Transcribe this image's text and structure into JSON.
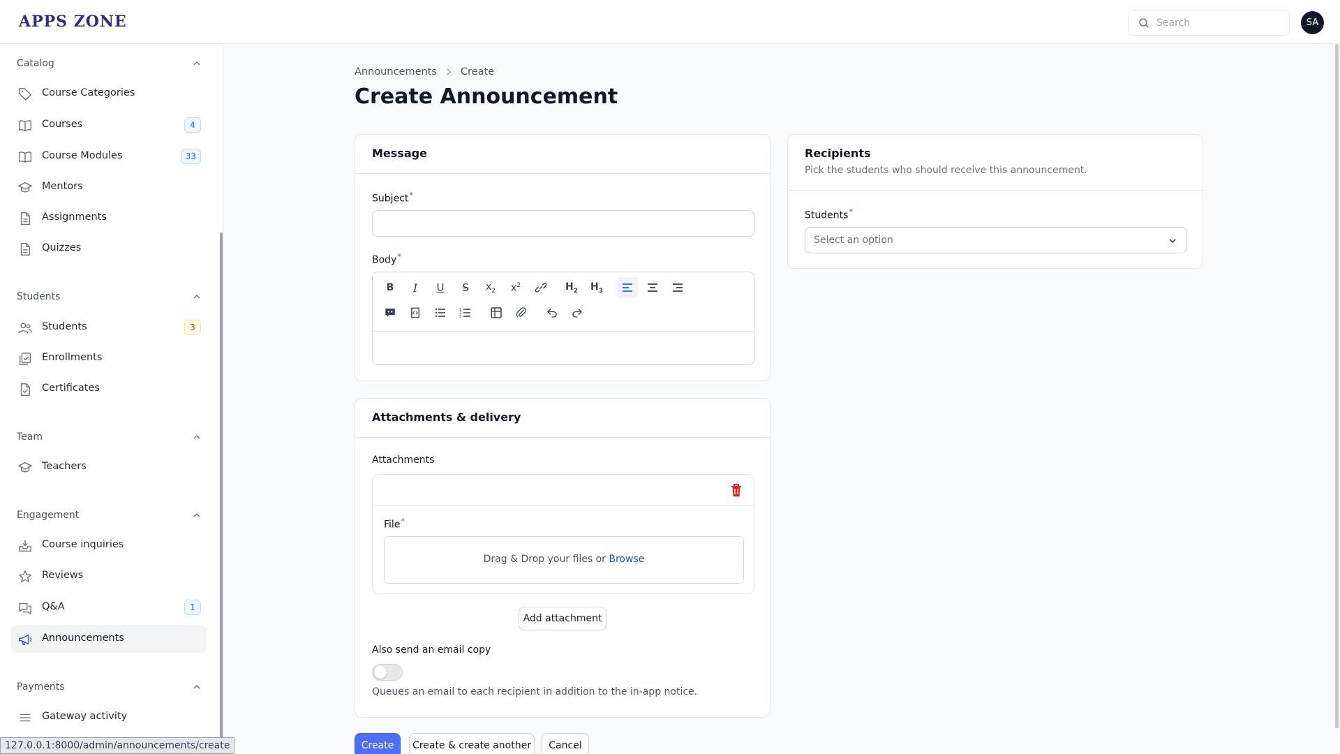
{
  "app": {
    "logo": "APPS ZONE",
    "avatar_initials": "SA"
  },
  "search": {
    "placeholder": "Search"
  },
  "sidebar": {
    "groups": [
      {
        "label": "Catalog",
        "items": [
          {
            "label": "Course Categories",
            "icon": "tag-icon"
          },
          {
            "label": "Courses",
            "icon": "book-icon",
            "badge": "4"
          },
          {
            "label": "Course Modules",
            "icon": "book-icon",
            "badge": "33"
          },
          {
            "label": "Mentors",
            "icon": "academic-cap-icon"
          },
          {
            "label": "Assignments",
            "icon": "document-icon"
          },
          {
            "label": "Quizzes",
            "icon": "document-icon"
          }
        ]
      },
      {
        "label": "Students",
        "items": [
          {
            "label": "Students",
            "icon": "users-icon",
            "badge": "3"
          },
          {
            "label": "Enrollments",
            "icon": "clipboard-check-icon"
          },
          {
            "label": "Certificates",
            "icon": "document-check-icon"
          }
        ]
      },
      {
        "label": "Team",
        "items": [
          {
            "label": "Teachers",
            "icon": "academic-cap-icon"
          }
        ]
      },
      {
        "label": "Engagement",
        "items": [
          {
            "label": "Course inquiries",
            "icon": "inbox-icon"
          },
          {
            "label": "Reviews",
            "icon": "star-icon"
          },
          {
            "label": "Q&A",
            "icon": "chat-bubbles-icon",
            "badge": "1"
          },
          {
            "label": "Announcements",
            "icon": "megaphone-icon",
            "active": true
          }
        ]
      },
      {
        "label": "Payments",
        "items": [
          {
            "label": "Gateway activity",
            "icon": "list-icon"
          }
        ]
      }
    ]
  },
  "status_url": "127.0.0.1:8000/admin/announcements/create",
  "breadcrumb": {
    "parent": "Announcements",
    "current": "Create"
  },
  "page_title": "Create Announcement",
  "message_section": {
    "title": "Message",
    "subject_label": "Subject",
    "body_label": "Body"
  },
  "recipients_section": {
    "title": "Recipients",
    "description": "Pick the students who should receive this announcement.",
    "students_label": "Students",
    "students_placeholder": "Select an option"
  },
  "attachments_section": {
    "title": "Attachments & delivery",
    "attachments_label": "Attachments",
    "file_label": "File",
    "dropzone_text": "Drag & Drop your files or",
    "dropzone_link": "Browse",
    "add_attachment": "Add attachment",
    "email_copy_label": "Also send an email copy",
    "email_copy_enabled": false,
    "email_copy_help": "Queues an email to each recipient in addition to the in-app notice."
  },
  "actions": {
    "create": "Create",
    "create_another": "Create & create another",
    "cancel": "Cancel"
  },
  "colors": {
    "primary": "#4f6ef7",
    "danger": "#dc2626",
    "link": "#1d4ed8"
  }
}
